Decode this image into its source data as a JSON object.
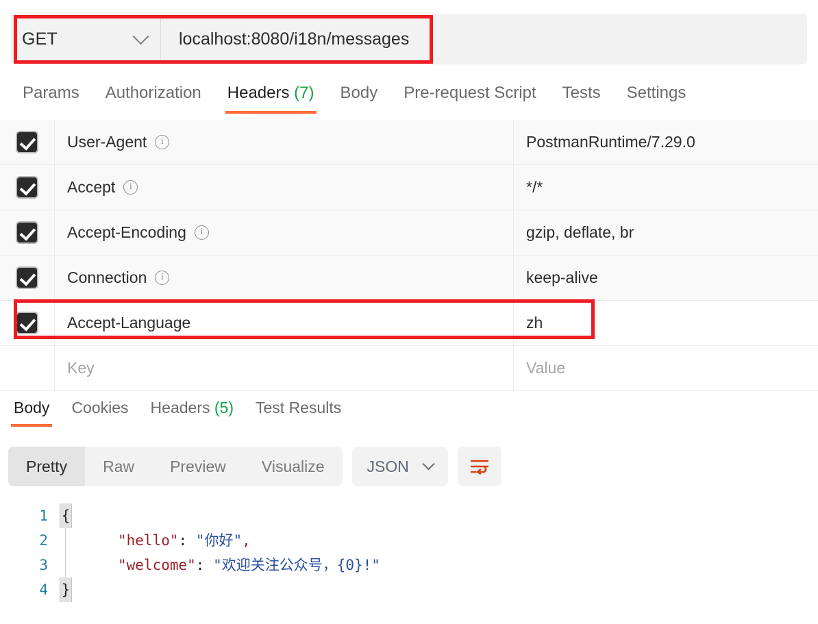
{
  "request": {
    "method": "GET",
    "url": "localhost:8080/i18n/messages",
    "method_dropdown_icon": "chevron-down-icon"
  },
  "request_tabs": [
    {
      "label": "Params",
      "active": false,
      "count": ""
    },
    {
      "label": "Authorization",
      "active": false,
      "count": ""
    },
    {
      "label": "Headers",
      "active": true,
      "count": "(7)"
    },
    {
      "label": "Body",
      "active": false,
      "count": ""
    },
    {
      "label": "Pre-request Script",
      "active": false,
      "count": ""
    },
    {
      "label": "Tests",
      "active": false,
      "count": ""
    },
    {
      "label": "Settings",
      "active": false,
      "count": ""
    }
  ],
  "headers_table": {
    "rows": [
      {
        "checked": true,
        "key": "User-Agent",
        "value": "PostmanRuntime/7.29.0",
        "info": true,
        "highlighted": false
      },
      {
        "checked": true,
        "key": "Accept",
        "value": "*/*",
        "info": true,
        "highlighted": false
      },
      {
        "checked": true,
        "key": "Accept-Encoding",
        "value": "gzip, deflate, br",
        "info": true,
        "highlighted": false
      },
      {
        "checked": true,
        "key": "Connection",
        "value": "keep-alive",
        "info": true,
        "highlighted": false
      },
      {
        "checked": true,
        "key": "Accept-Language",
        "value": "zh",
        "info": false,
        "highlighted": true
      }
    ],
    "empty_row": {
      "key_placeholder": "Key",
      "value_placeholder": "Value"
    }
  },
  "response_tabs": [
    {
      "label": "Body",
      "active": true,
      "count": ""
    },
    {
      "label": "Cookies",
      "active": false,
      "count": ""
    },
    {
      "label": "Headers",
      "active": false,
      "count": "(5)"
    },
    {
      "label": "Test Results",
      "active": false,
      "count": ""
    }
  ],
  "format_toolbar": {
    "views": [
      {
        "label": "Pretty",
        "active": true
      },
      {
        "label": "Raw",
        "active": false
      },
      {
        "label": "Preview",
        "active": false
      },
      {
        "label": "Visualize",
        "active": false
      }
    ],
    "language": "JSON",
    "language_icon": "chevron-down-icon",
    "wrap_button_icon": "word-wrap-icon"
  },
  "body_code": {
    "lines": [
      {
        "no": "1",
        "brace": "{",
        "guide": false,
        "text": ""
      },
      {
        "no": "2",
        "brace": "",
        "guide": true,
        "text": "    \"hello\": \"你好\","
      },
      {
        "no": "3",
        "brace": "",
        "guide": true,
        "text": "    \"welcome\": \"欢迎关注公众号，{0}!\""
      },
      {
        "no": "4",
        "brace": "}",
        "guide": false,
        "text": ""
      }
    ],
    "line1_text": "",
    "line2_key": "\"hello\"",
    "line2_colon": ": ",
    "line2_value": "\"你好\"",
    "line2_comma": ",",
    "line3_key": "\"welcome\"",
    "line3_colon": ": ",
    "line3_value": "\"欢迎关注公众号，{0}!\"",
    "line4_text": ""
  },
  "colors": {
    "accent_orange": "#ff6c37",
    "count_green": "#0ea54a",
    "annotation_red": "#ed1c24",
    "json_key": "#9c2128",
    "json_string": "#2b4ea2",
    "line_number": "#1f7fa8"
  }
}
